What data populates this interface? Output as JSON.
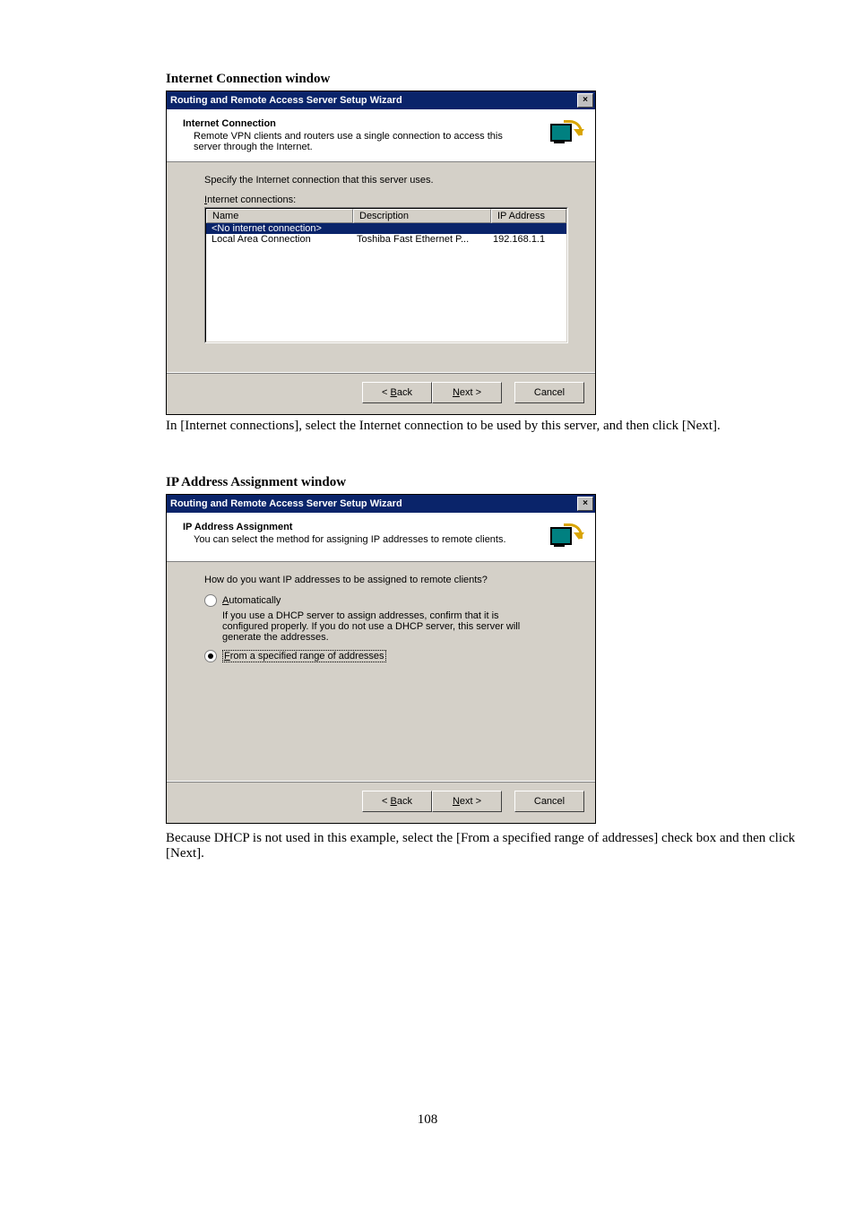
{
  "doc": {
    "section1_title": "Internet Connection window",
    "section1_caption": "In [Internet connections], select the Internet connection to be used by this server, and then click [Next].",
    "section2_title": "IP Address Assignment window",
    "section2_caption": "Because DHCP is not used in this example, select the [From a specified range of addresses] check box and then click [Next].",
    "page_number": "108"
  },
  "common": {
    "wizard_title": "Routing and Remote Access Server Setup Wizard",
    "close_x": "×",
    "btn_back": "< Back",
    "btn_next": "Next >",
    "btn_cancel": "Cancel"
  },
  "dlg1": {
    "header_title": "Internet Connection",
    "header_sub": "Remote VPN clients and routers use a single connection to access this server through the Internet.",
    "instruction": "Specify the Internet connection that this server uses.",
    "list_label": "Internet connections:",
    "cols": {
      "name": "Name",
      "desc": "Description",
      "ip": "IP Address"
    },
    "rows": [
      {
        "name": "<No internet connection>",
        "desc": "",
        "ip": "",
        "selected": true
      },
      {
        "name": "Local Area Connection",
        "desc": "Toshiba Fast Ethernet P...",
        "ip": "192.168.1.1",
        "selected": false
      }
    ]
  },
  "dlg2": {
    "header_title": "IP Address Assignment",
    "header_sub": "You can select the method for assigning IP addresses to remote clients.",
    "question": "How do you want IP addresses to be assigned to remote clients?",
    "opt_auto": "Automatically",
    "opt_auto_desc": "If you use a DHCP server to assign addresses, confirm that it is configured properly. If you do not use a DHCP server, this server will generate the addresses.",
    "opt_range": "From a specified range of addresses"
  }
}
